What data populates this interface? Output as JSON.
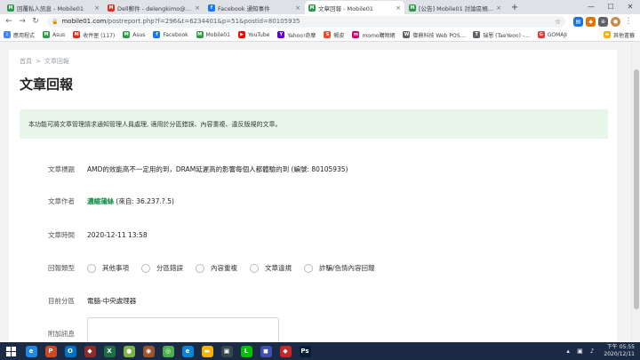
{
  "browser": {
    "tabs": [
      {
        "title": "回覆私人訊息 - Mobile01",
        "favicon": "M",
        "color": "#2e9b48",
        "active": false
      },
      {
        "title": "Dell郵件 - delengkimo@gmail.c...",
        "favicon": "M",
        "color": "#d93025",
        "active": false
      },
      {
        "title": "Facebook 通知事件",
        "favicon": "f",
        "color": "#1877f2",
        "active": false
      },
      {
        "title": "文章回報 - Mobile01",
        "favicon": "M",
        "color": "#2e9b48",
        "active": true
      },
      {
        "title": "[公告] Mobile01 討論區規則與操...",
        "favicon": "M",
        "color": "#2e9b48",
        "active": false
      }
    ],
    "new_tab": "+",
    "window_controls": {
      "minimize": "—",
      "maximize": "☐",
      "close": "✕"
    },
    "address": {
      "host": "mobile01.com",
      "path": "/postreport.php?f=296&t=6234401&p=51&postid=80105935"
    },
    "bookmarks": [
      {
        "label": "應用程式",
        "icon": "apps-icon",
        "color": "#4285f4"
      },
      {
        "label": "Asus",
        "icon": "M",
        "color": "#2e9b48"
      },
      {
        "label": "收件匣 (117)",
        "icon": "M",
        "color": "#d93025"
      },
      {
        "label": "Asus",
        "icon": "M",
        "color": "#2e9b48"
      },
      {
        "label": "Facebook",
        "icon": "f",
        "color": "#1877f2"
      },
      {
        "label": "Mobile01",
        "icon": "M",
        "color": "#2e9b48"
      },
      {
        "label": "YouTube",
        "icon": "▶",
        "color": "#ff0000"
      },
      {
        "label": "Yahoo!奇摩",
        "icon": "Y",
        "color": "#6001d2"
      },
      {
        "label": "蝦皮",
        "icon": "S",
        "color": "#ee4d2d"
      },
      {
        "label": "momo購物網",
        "icon": "m",
        "color": "#d6006e"
      },
      {
        "label": "御鼎科技 Web POS...",
        "icon": "W",
        "color": "#5f6368"
      },
      {
        "label": "瑞恩 (TaeYeon) -...",
        "icon": "T",
        "color": "#5f6368"
      },
      {
        "label": "GOMAJI",
        "icon": "G",
        "color": "#e23b3b"
      }
    ],
    "other_bookmarks": "其他書籤"
  },
  "page": {
    "breadcrumb": {
      "home": "首頁",
      "separator": ">",
      "current": "文章回報"
    },
    "title": "文章回報",
    "notice": "本功能可將文章管理請求通知管理人員處理, 適用於分區錯誤、內容重複、違反版規的文章。",
    "fields": {
      "article_title_label": "文章標題",
      "article_title_value": "AMD的效能高不一定用的到，DRAM延遲高的影響每個人都體驗的到 (編號: 80105935)",
      "author_label": "文章作者",
      "author_name": "濃縮蒲絲",
      "author_source": "(來自: 36.237.?.5)",
      "time_label": "文章時間",
      "time_value": "2020-12-11 13:58",
      "report_type_label": "回報類型",
      "report_types": [
        "其他事項",
        "分區錯誤",
        "內容重複",
        "文章違規",
        "詐騙/色情內容回報"
      ],
      "section_label": "目前分區",
      "section_value": "電腦-中央處理器",
      "extra_label": "附加訊息"
    }
  },
  "taskbar": {
    "apps": [
      {
        "name": "ie",
        "glyph": "e",
        "color": "#1e88e5"
      },
      {
        "name": "powerpoint",
        "glyph": "P",
        "color": "#d24726"
      },
      {
        "name": "outlook",
        "glyph": "O",
        "color": "#0072c6"
      },
      {
        "name": "game",
        "glyph": "◆",
        "color": "#8e2b2b"
      },
      {
        "name": "excel",
        "glyph": "X",
        "color": "#1d7044"
      },
      {
        "name": "app-green",
        "glyph": "●",
        "color": "#7cb342"
      },
      {
        "name": "app-photo",
        "glyph": "◉",
        "color": "#a0522d"
      },
      {
        "name": "chrome",
        "glyph": "◎",
        "color": "#4caf50"
      },
      {
        "name": "edge",
        "glyph": "e",
        "color": "#0a84d6"
      },
      {
        "name": "folder",
        "glyph": "▬",
        "color": "#f4b400"
      },
      {
        "name": "app-dark",
        "glyph": "▣",
        "color": "#37474f"
      },
      {
        "name": "line",
        "glyph": "L",
        "color": "#00c300"
      },
      {
        "name": "app-blue",
        "glyph": "◼",
        "color": "#3f51b5"
      },
      {
        "name": "app-game",
        "glyph": "◆",
        "color": "#c62828"
      },
      {
        "name": "photoshop",
        "glyph": "Ps",
        "color": "#001e36"
      }
    ],
    "clock_time": "下午 05:55",
    "clock_date": "2020/12/11"
  }
}
